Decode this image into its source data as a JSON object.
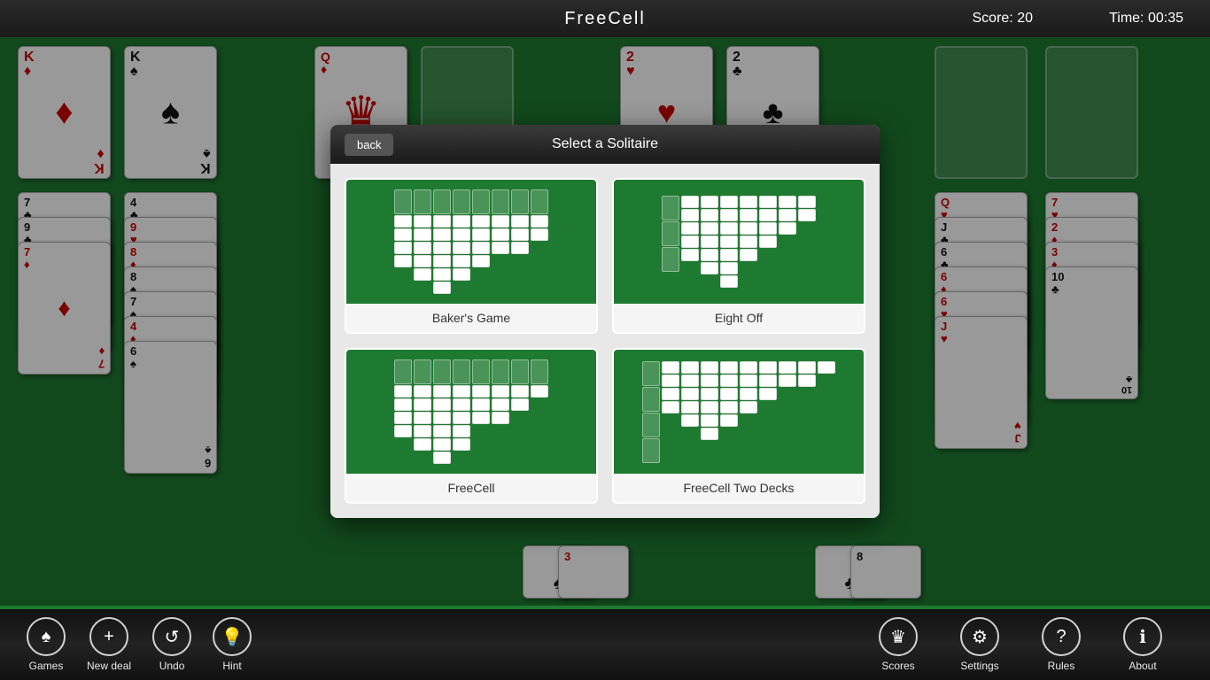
{
  "header": {
    "title": "FreeCell",
    "score_label": "Score:",
    "score_value": "20",
    "time_label": "Time:",
    "time_value": "00:35"
  },
  "dialog": {
    "back_label": "back",
    "title": "Select a Solitaire",
    "options": [
      {
        "id": "bakers-game",
        "label": "Baker's Game"
      },
      {
        "id": "eight-off",
        "label": "Eight Off"
      },
      {
        "id": "freecell",
        "label": "FreeCell"
      },
      {
        "id": "freecell-two-decks",
        "label": "FreeCell Two Decks"
      }
    ]
  },
  "toolbar": {
    "left": [
      {
        "id": "games",
        "label": "Games",
        "icon": "♠"
      },
      {
        "id": "new-deal",
        "label": "New deal",
        "icon": "+"
      },
      {
        "id": "undo",
        "label": "Undo",
        "icon": "↺"
      },
      {
        "id": "hint",
        "label": "Hint",
        "icon": "💡"
      }
    ],
    "right": [
      {
        "id": "scores",
        "label": "Scores",
        "icon": "♛"
      },
      {
        "id": "settings",
        "label": "Settings",
        "icon": "⚙"
      },
      {
        "id": "rules",
        "label": "Rules",
        "icon": "?"
      },
      {
        "id": "about",
        "label": "About",
        "icon": "ℹ"
      }
    ]
  },
  "cards": {
    "col1": [
      "K♦",
      "9♣",
      "7♦"
    ],
    "col2": [
      "K♠",
      "4♣",
      "9♥",
      "8♦",
      "8♠",
      "7♠",
      "4♦",
      "6♠"
    ],
    "col3_top": "Q♦",
    "col4_top": "2♥",
    "col5_top": "2♣",
    "col8": [
      "Q♥",
      "J♣",
      "6♣",
      "6♦",
      "6♥",
      "J♥"
    ],
    "col9": [
      "7♥",
      "2♦",
      "3♦",
      "10♣"
    ]
  }
}
